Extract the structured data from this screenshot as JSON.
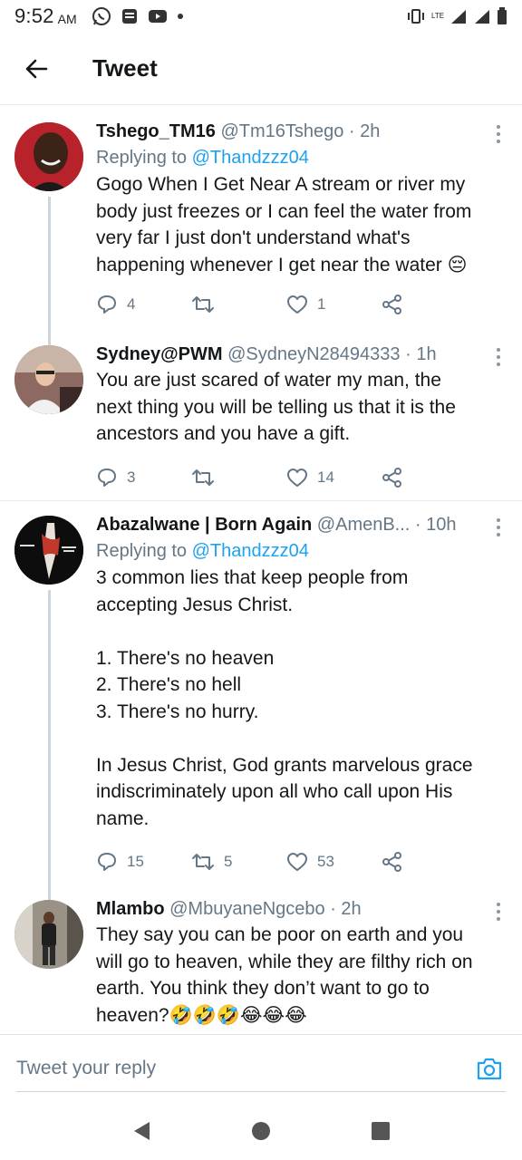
{
  "status_bar": {
    "time": "9:52",
    "ampm": "AM",
    "network": "LTE"
  },
  "header": {
    "title": "Tweet"
  },
  "tweets": [
    {
      "name": "Tshego_TM16",
      "handle": "@Tm16Tshego",
      "time": "· 2h",
      "replying_label": "Replying to",
      "replying_to": "@Thandzzz04",
      "text": "Gogo When I Get Near A stream or river my body just freezes or I can feel the water from very far I just don't understand what's happening whenever I get near the water",
      "text_emoji": "😔",
      "replies": "4",
      "retweets": "",
      "likes": "1"
    },
    {
      "name": "Sydney@PWM",
      "handle": "@SydneyN28494333",
      "time": "· 1h",
      "text": "You are just scared of water my man, the next thing you will be telling us that it is the ancestors and you have a gift.",
      "replies": "3",
      "retweets": "",
      "likes": "14"
    },
    {
      "name": "Abazalwane | Born Again",
      "handle": "@AmenB...",
      "time": "· 10h",
      "replying_label": "Replying to",
      "replying_to": "@Thandzzz04",
      "text": "3 common lies that keep people from accepting Jesus Christ.\n\n1. There's no heaven\n2. There's no hell\n3. There's no hurry.\n\nIn Jesus Christ, God grants marvelous grace indiscriminately upon all who call upon His name.",
      "replies": "15",
      "retweets": "5",
      "likes": "53"
    },
    {
      "name": "Mlambo",
      "handle": "@MbuyaneNgcebo",
      "time": "· 2h",
      "text": "They say you can be poor on earth and you will go to heaven, while they are filthy rich on earth. You think they don’t want to go to heaven?",
      "text_emoji": "🤣🤣🤣😂😂😂"
    }
  ],
  "compose": {
    "placeholder": "Tweet your reply"
  },
  "colors": {
    "accent": "#1da1f2",
    "secondary_text": "#657786",
    "divider": "#e6ecf0"
  }
}
